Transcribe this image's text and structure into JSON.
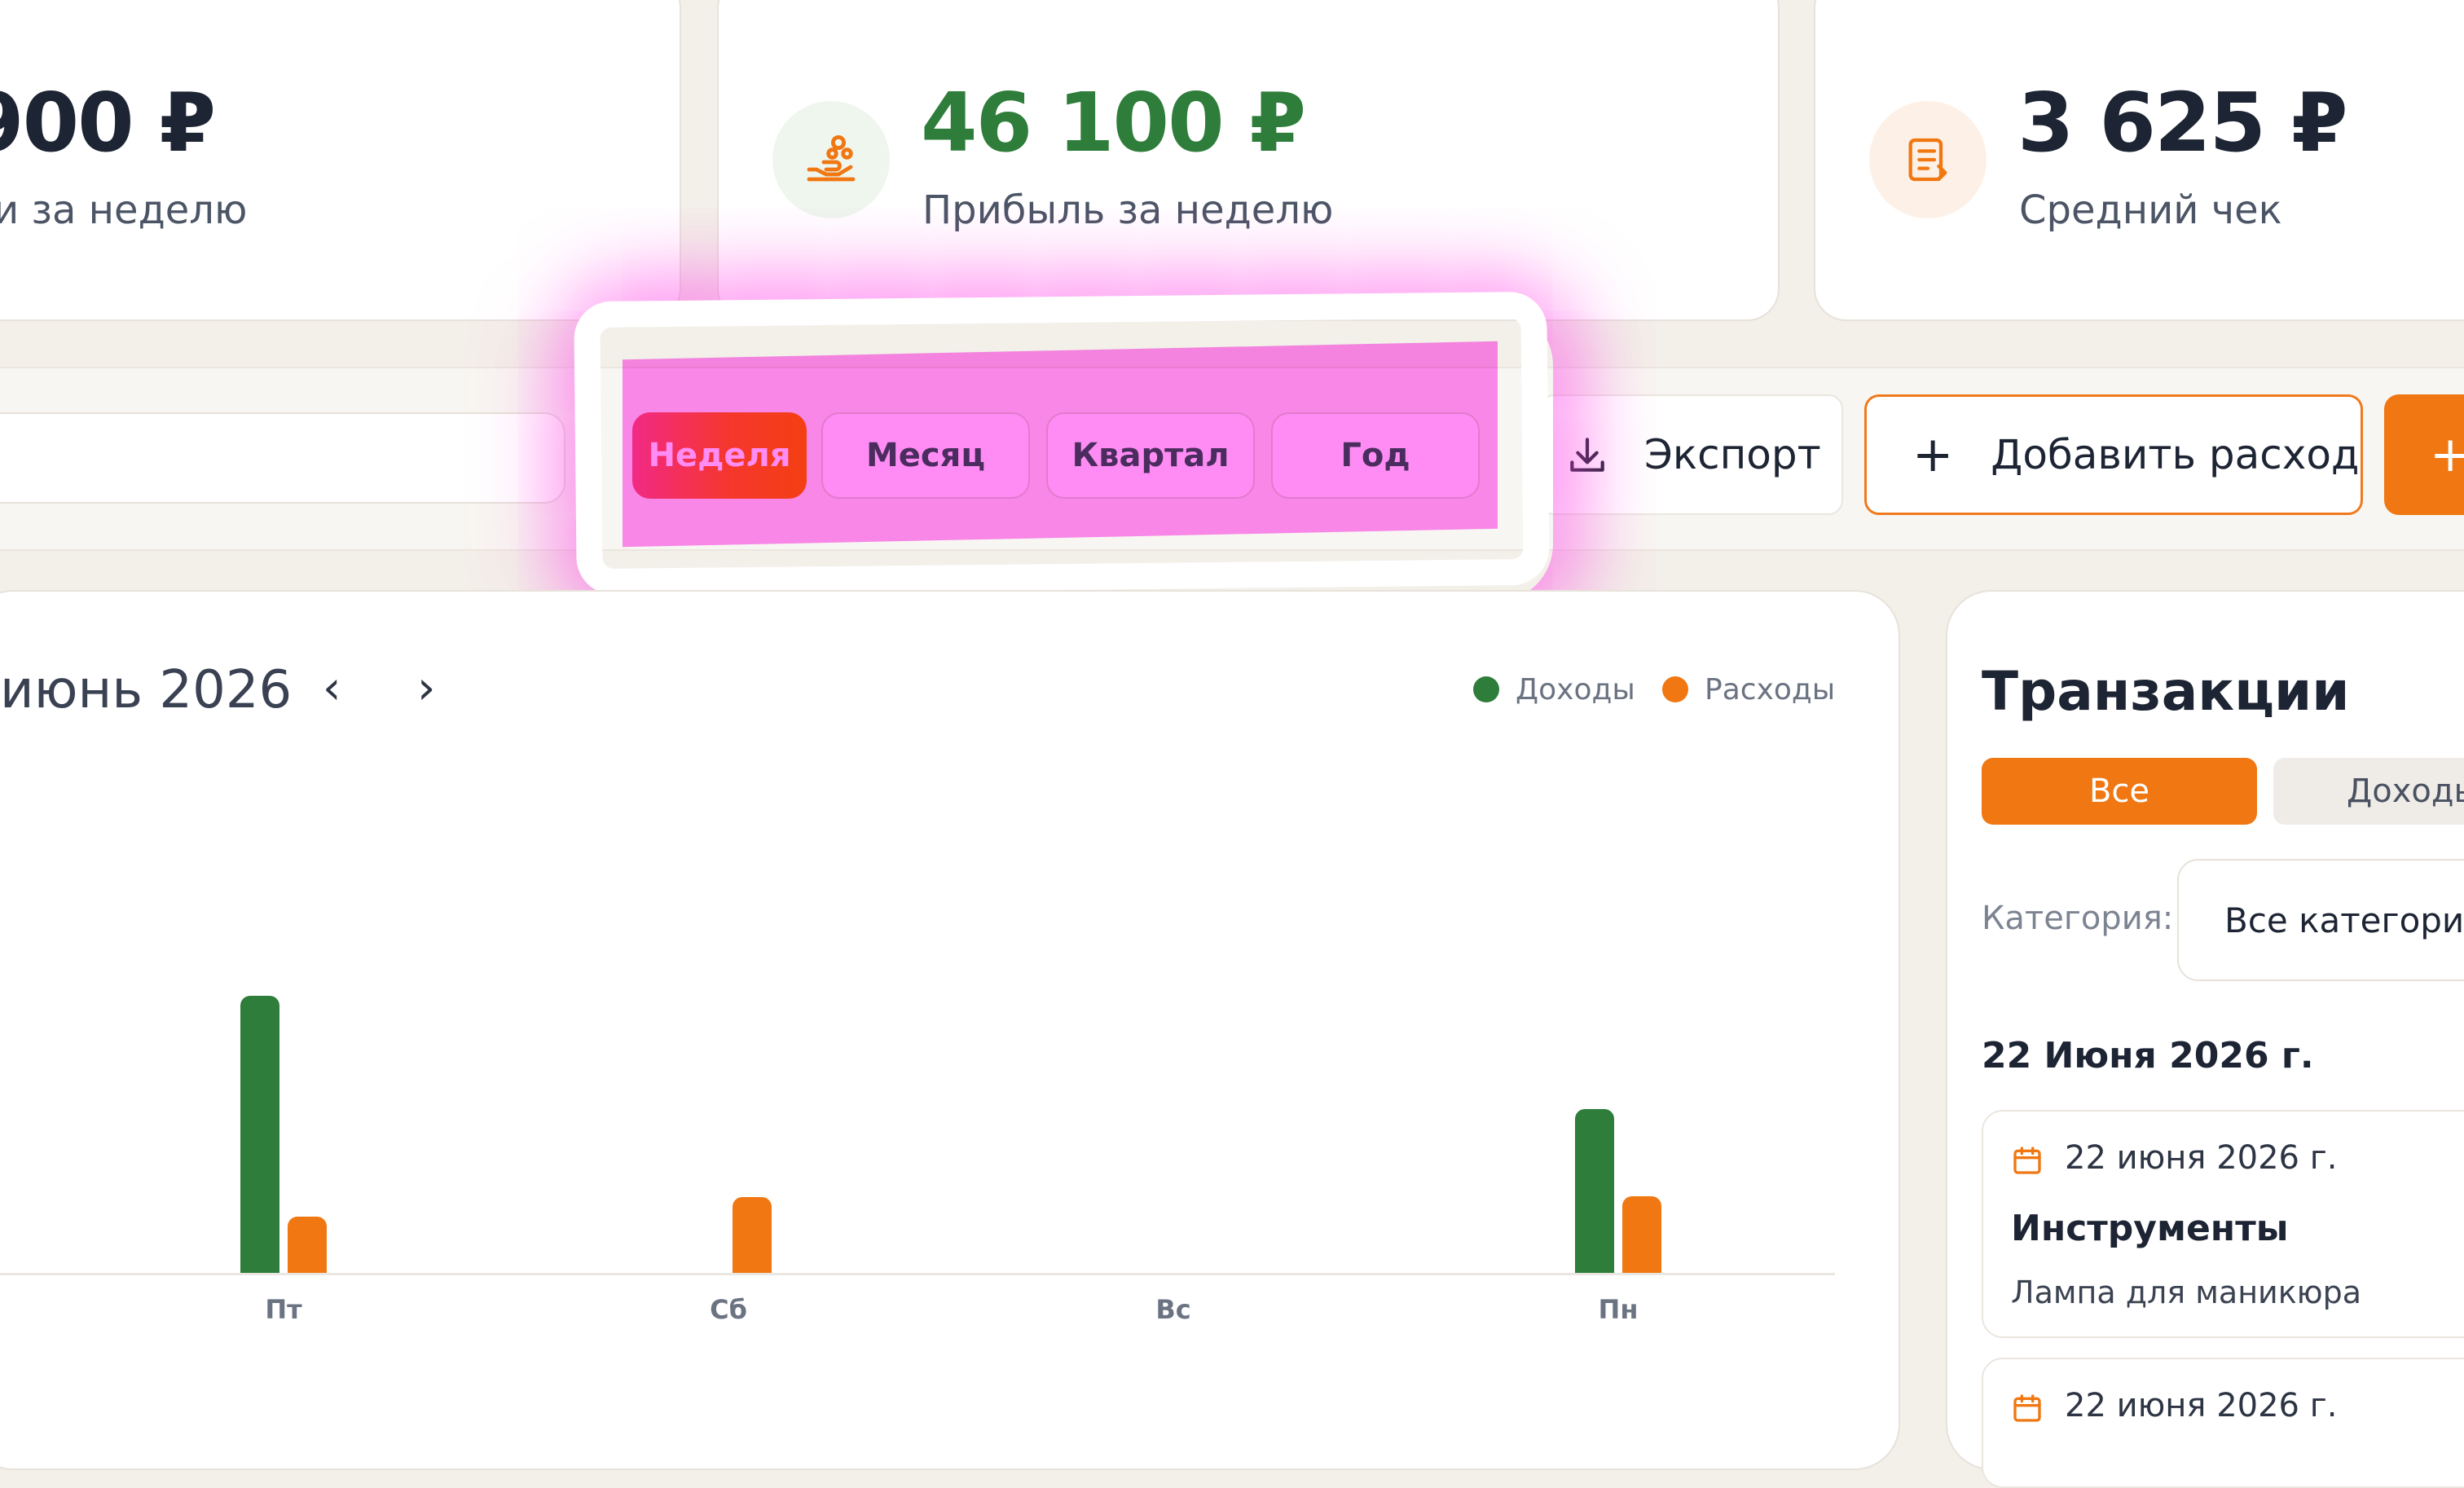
{
  "stats": [
    {
      "value": "900 ₽",
      "label": "и за неделю",
      "icon": "wallet-icon"
    },
    {
      "value": "46 100 ₽",
      "label": "Прибыль за неделю",
      "icon": "hand-coins-icon",
      "color": "#2e7d3a"
    },
    {
      "value": "3 625 ₽",
      "label": "Средний чек",
      "icon": "receipt-icon",
      "color": "#1d2433"
    }
  ],
  "toolbar": {
    "periods": [
      "Неделя",
      "Месяц",
      "Квартал",
      "Год"
    ],
    "active_period": "Неделя",
    "export_label": "Экспорт",
    "add_expense_label": "Добавить расход",
    "add_income_label": "+"
  },
  "chart": {
    "month_label": "июнь 2026",
    "legend": [
      "Доходы",
      "Расходы"
    ]
  },
  "chart_data": {
    "type": "bar",
    "categories": [
      "Пт",
      "Сб",
      "Вс",
      "Пн"
    ],
    "series": [
      {
        "name": "Доходы",
        "color": "#2e7d3a",
        "values": [
          27000,
          0,
          0,
          16000
        ]
      },
      {
        "name": "Расходы",
        "color": "#f07712",
        "values": [
          5500,
          7400,
          0,
          7500
        ]
      }
    ],
    "ylim": [
      0,
      27000
    ],
    "grid": false,
    "legend_position": "top-right"
  },
  "transactions": {
    "title": "Транзакции",
    "tabs": [
      "Все",
      "Доходы"
    ],
    "category_label": "Категория:",
    "category_value": "Все категории",
    "date_header": "22 Июня 2026 г.",
    "items": [
      {
        "date": "22 июня 2026 г.",
        "title": "Инструменты",
        "subtitle": "Лампа для маникюра"
      },
      {
        "date": "22 июня 2026 г.",
        "title": "",
        "subtitle": ""
      }
    ]
  }
}
